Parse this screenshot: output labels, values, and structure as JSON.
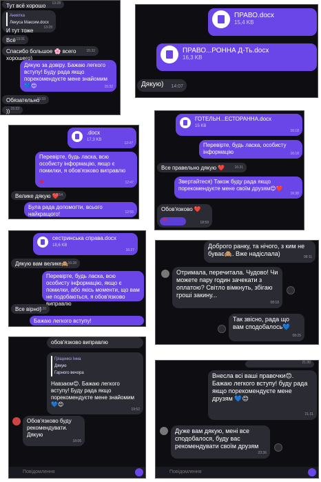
{
  "p1": {
    "m1": {
      "text": "Тут всё хорошо",
      "time": "13:28"
    },
    "reply_name": "Анкетка",
    "reply_text": "Лекуса Максим.docx",
    "m2": {
      "text": "И тут тоже",
      "time": "13:28"
    },
    "m3": {
      "text": "Всё",
      "time": "13:31"
    },
    "m4": {
      "text": "Спасибо большое 🌸 всего хорошего)",
      "time": "15:32"
    },
    "m5": {
      "text": "Дякую за довіру. Бажаю легкого вступу! Буду рада якщо порекомендуєте мене знайомим💙😊",
      "time": "15:32"
    },
    "m6": {
      "text": "Обязательно",
      "time": "15:33"
    },
    "m7": {
      "text": ")) ",
      "time": "15:33"
    }
  },
  "p2": {
    "f1": {
      "name": "ПРАВО.docx",
      "size": "15,4 KB"
    },
    "f2": {
      "name": "ПРАВО...РОННА Д-Ть.docx",
      "size": "16,3 KB"
    },
    "m1": {
      "text": "Дякую)",
      "time": "14:07"
    }
  },
  "p3": {
    "f1": {
      "name": ".docx",
      "size": "17,3 KB",
      "time": "12:47"
    },
    "m1": {
      "text": "Перевірте, будь ласка, всю особисту інформацію, якщо є помилки, я обов'язково виправлю",
      "time": "12:47"
    },
    "m2": {
      "text": "Велике дякую ❤️",
      "time": "12:54"
    },
    "m3": {
      "text": "Була рада допомогти, всього найкращого!",
      "time": "12:55"
    }
  },
  "p4": {
    "f1": {
      "name": "ГОТЕЛЬН...ЕСТОРАННА.docx",
      "size": "15 KB",
      "time": "16:18"
    },
    "m1": {
      "text": "Перевірте, будь ласка, особисту інформацію",
      "time": "16:18"
    },
    "m2": {
      "text": "Все правельно дякую ❤️",
      "time": "16:31"
    },
    "m3": {
      "text": "Звертайтеся) Також буду рада якщо порекомендуєте мене своїм друзям😊❤️",
      "time": "16:38"
    },
    "m4": {
      "text": "Обов'язково ❤️",
      "time": "18:59"
    }
  },
  "p5": {
    "f1": {
      "name": "сестринська справа.docx",
      "size": "18,6 KB",
      "time": "16:27"
    },
    "m1": {
      "text": "Дякую вам велике🙈",
      "time": "16:28"
    },
    "m2": {
      "text": "Перевірте, будь ласка, всю особисту інформацію, якщо є помилки, або якісь моменти, що вам не подобаються, я обов'язково виправлю",
      "time": ""
    },
    "m3": {
      "text": "Все вірно)",
      "time": "18:20"
    },
    "m4": {
      "text": "Бажаю легкого вступу!",
      "time": ""
    }
  },
  "p6": {
    "m1": {
      "text": "Доброго ранку, та нічого, з ким не буває🙈. Вже надіслала)",
      "time": "08:11"
    },
    "m2": {
      "text": "Отримала, перечитала. Чудово! Чи можете пару годин зачекати з оплатою? Світло вімкнуть, збігаю гроші закину...",
      "time": "08:18"
    },
    "m3": {
      "text": "Так звісно, рада що вам сподобалось💙",
      "time": "08:25"
    }
  },
  "p7": {
    "m0": {
      "text": "обов'язково виправлю"
    },
    "quote_name": "Гріщенко Інна",
    "quote_text": "Дякую\nГарного вечора",
    "m1": {
      "text": "Навзаєм😊. Бажаю легкого вступу! Буду рада якщо порекомендуєте мене знайомим💙😊",
      "time": "19:52"
    },
    "m2": {
      "text": "Обов'язково буду рекомендувати. Дякую",
      "time": "18:06"
    },
    "input": "Повідомлення"
  },
  "p8": {
    "t0": "21:30",
    "m1": {
      "text": "Внесла всі ваші правочки😊. Бажаю легкого вступу! буду рада якщо порекомендуєте мене друзям 💙😊",
      "time": "21:31"
    },
    "m2": {
      "text": "Дуже вам дякую, мені все сподобалося, буду вас рекомендувати своїм друзям",
      "time": "23:36"
    },
    "input": "Повідомлення"
  }
}
